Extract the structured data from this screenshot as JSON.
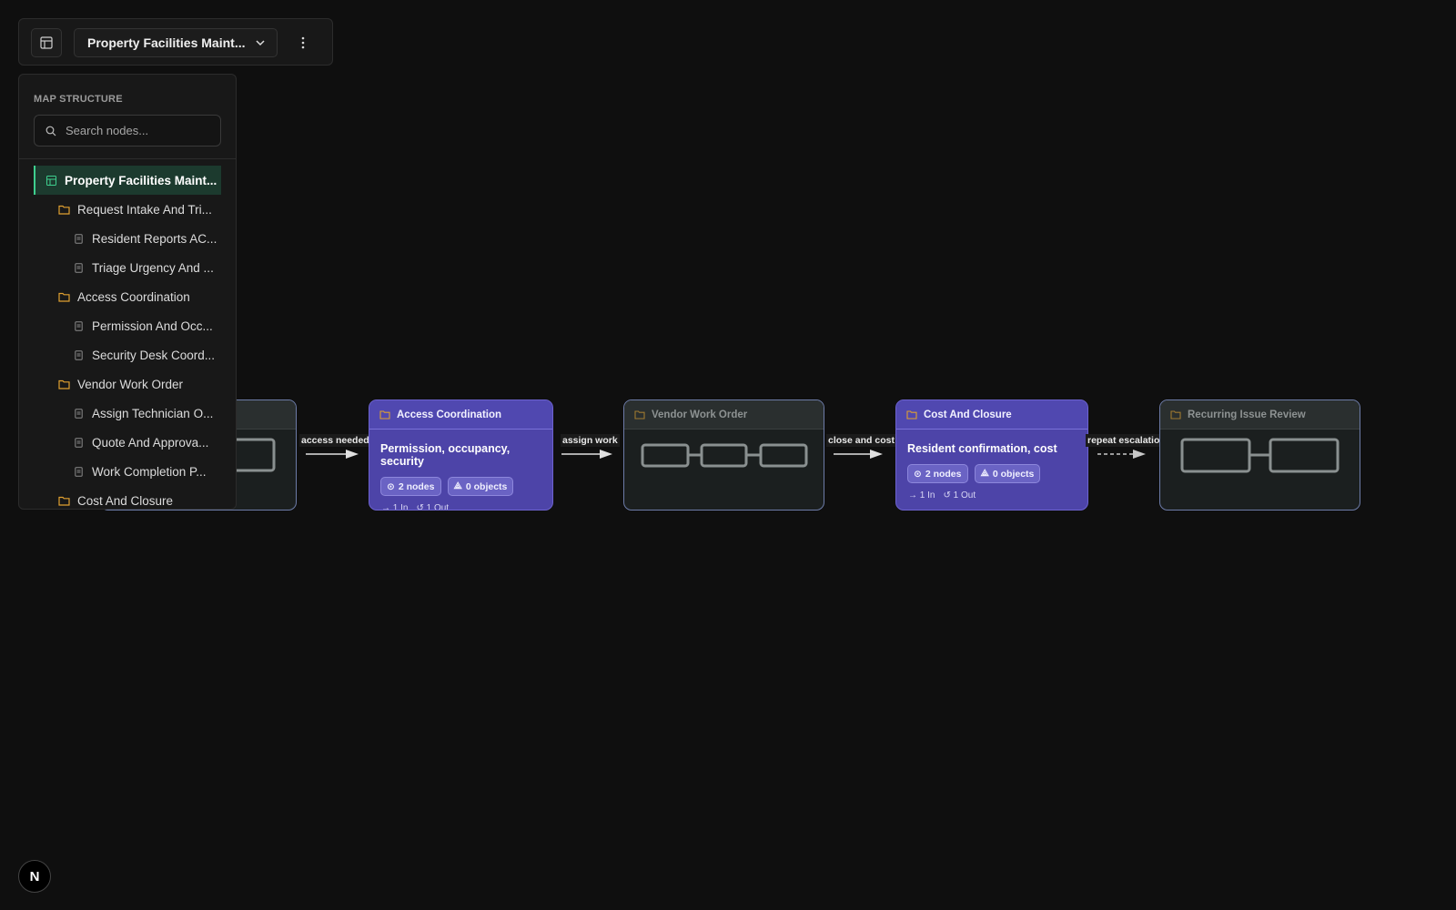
{
  "toolbar": {
    "map_name": "Property Facilities Maint..."
  },
  "sidebar": {
    "heading": "MAP STRUCTURE",
    "search_placeholder": "Search nodes...",
    "items": [
      {
        "label": "Property Facilities Maint...",
        "level": 0,
        "type": "map",
        "active": true
      },
      {
        "label": "Request Intake And Tri...",
        "level": 1,
        "type": "folder"
      },
      {
        "label": "Resident Reports AC...",
        "level": 2,
        "type": "doc"
      },
      {
        "label": "Triage Urgency And ...",
        "level": 2,
        "type": "doc"
      },
      {
        "label": "Access Coordination",
        "level": 1,
        "type": "folder"
      },
      {
        "label": "Permission And Occ...",
        "level": 2,
        "type": "doc"
      },
      {
        "label": "Security Desk Coord...",
        "level": 2,
        "type": "doc"
      },
      {
        "label": "Vendor Work Order",
        "level": 1,
        "type": "folder"
      },
      {
        "label": "Assign Technician O...",
        "level": 2,
        "type": "doc"
      },
      {
        "label": "Quote And Approva...",
        "level": 2,
        "type": "doc"
      },
      {
        "label": "Work Completion P...",
        "level": 2,
        "type": "doc"
      },
      {
        "label": "Cost And Closure",
        "level": 1,
        "type": "folder"
      }
    ]
  },
  "canvas": {
    "nodes": [
      {
        "title": "Access Coordination",
        "subtitle": "Permission, occupancy, security",
        "nodes_count": "2 nodes",
        "objects_count": "0 objects",
        "in": "1 In",
        "out": "1 Out"
      },
      {
        "title": "Vendor Work Order"
      },
      {
        "title": "Cost And Closure",
        "subtitle": "Resident confirmation, cost",
        "nodes_count": "2 nodes",
        "objects_count": "0 objects",
        "in": "1 In",
        "out": "1 Out"
      },
      {
        "title": "Recurring Issue Review"
      }
    ],
    "edges": [
      {
        "label": "access needed"
      },
      {
        "label": "assign work"
      },
      {
        "label": "close and cost"
      },
      {
        "label": "repeat escalation",
        "style": "dashed"
      }
    ]
  },
  "colors": {
    "background": "#0f0f0f",
    "expanded_node": "#4d44a8",
    "active_accent": "#3ecf8e",
    "folder_icon": "#e0a030"
  },
  "logo_letter": "N"
}
